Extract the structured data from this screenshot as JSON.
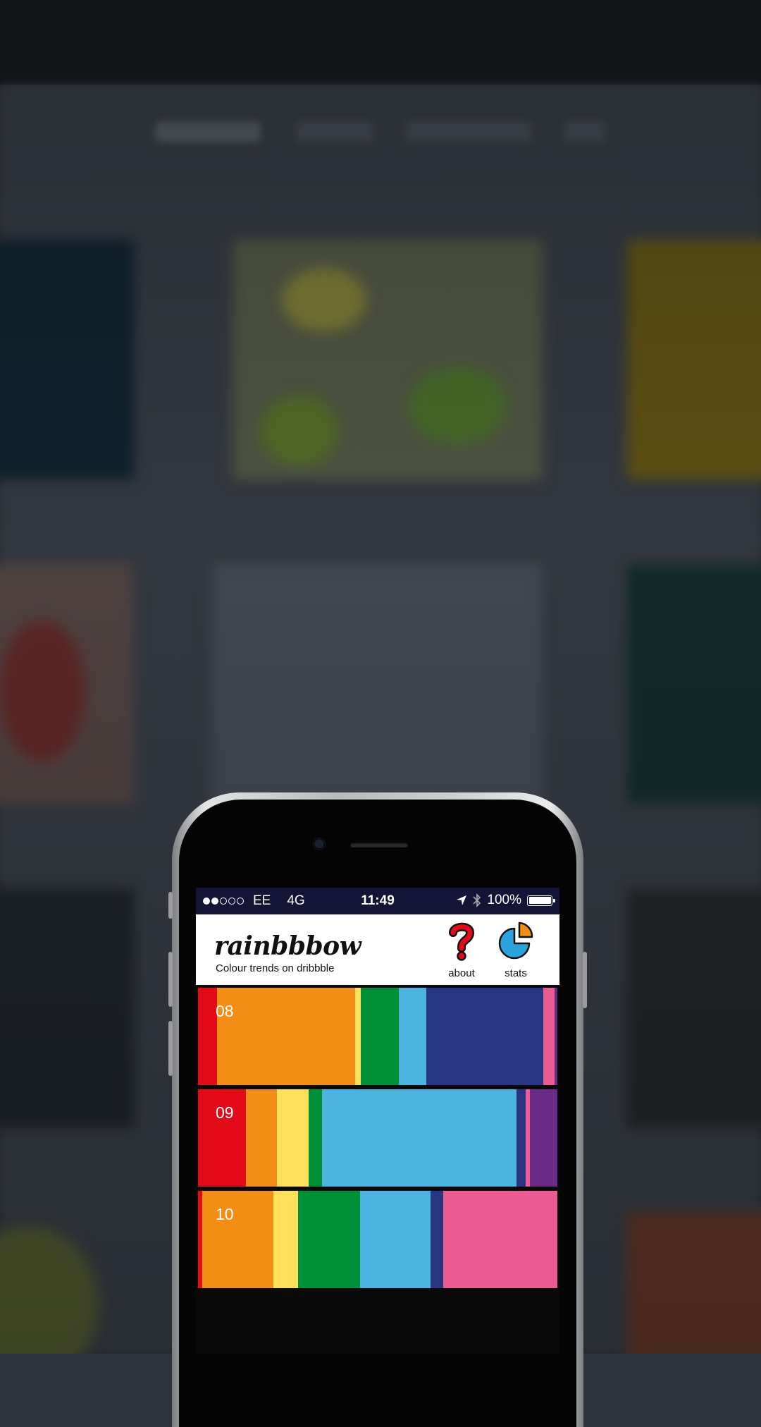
{
  "status_bar": {
    "signal_strength": 2,
    "signal_total": 5,
    "carrier": "EE",
    "network": "4G",
    "time": "11:49",
    "battery": "100%"
  },
  "app": {
    "logo": "rainbbbow",
    "tagline": "Colour trends on dribbble",
    "about_label": "about",
    "stats_label": "stats"
  },
  "colors": {
    "red": "#e30b17",
    "orange": "#f28e15",
    "yellow": "#ffe05a",
    "green": "#008f39",
    "lightblue": "#4db3e0",
    "navy": "#283583",
    "pink": "#ec5b92",
    "purple": "#6a2b87",
    "statusbar": "#141437"
  },
  "months": [
    {
      "label": "08",
      "segments": [
        {
          "color": "red",
          "weight": 0.053
        },
        {
          "color": "orange",
          "weight": 0.384
        },
        {
          "color": "yellow",
          "weight": 0.016
        },
        {
          "color": "green",
          "weight": 0.105
        },
        {
          "color": "lightblue",
          "weight": 0.078
        },
        {
          "color": "navy",
          "weight": 0.325
        },
        {
          "color": "pink",
          "weight": 0.031
        },
        {
          "color": "purple",
          "weight": 0.008
        }
      ]
    },
    {
      "label": "09",
      "segments": [
        {
          "color": "red",
          "weight": 0.133
        },
        {
          "color": "orange",
          "weight": 0.086
        },
        {
          "color": "yellow",
          "weight": 0.088
        },
        {
          "color": "green",
          "weight": 0.039
        },
        {
          "color": "lightblue",
          "weight": 0.541
        },
        {
          "color": "navy",
          "weight": 0.025
        },
        {
          "color": "pink",
          "weight": 0.012
        },
        {
          "color": "purple",
          "weight": 0.076
        }
      ]
    },
    {
      "label": "10",
      "segments": [
        {
          "color": "red",
          "weight": 0.012
        },
        {
          "color": "orange",
          "weight": 0.198
        },
        {
          "color": "yellow",
          "weight": 0.068
        },
        {
          "color": "green",
          "weight": 0.172
        },
        {
          "color": "lightblue",
          "weight": 0.197
        },
        {
          "color": "navy",
          "weight": 0.035
        },
        {
          "color": "pink",
          "weight": 0.318
        }
      ]
    }
  ]
}
